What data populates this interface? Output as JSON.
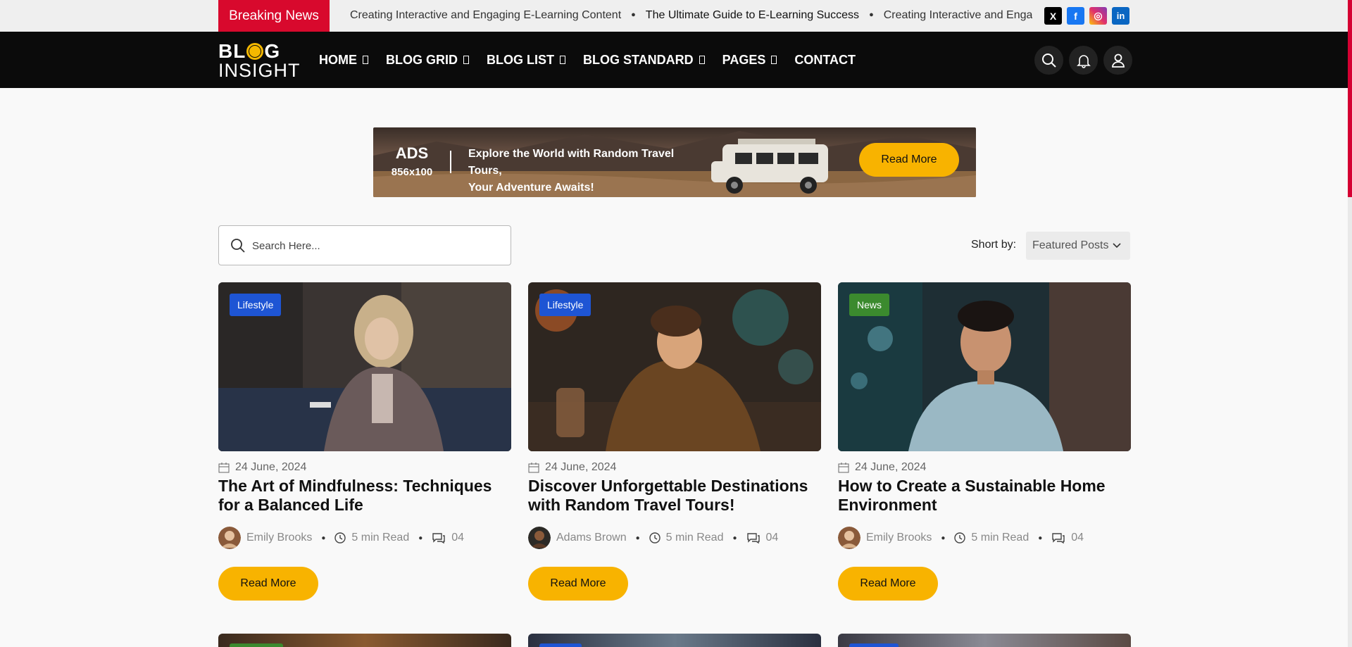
{
  "topbar": {
    "breaking_label": "Breaking News",
    "ticker": [
      "Creating Interactive and Engaging E-Learning Content",
      "The Ultimate Guide to E-Learning Success",
      "Creating Interactive and Engaging E-Learning Content"
    ],
    "socials": [
      {
        "name": "x-icon",
        "glyph": "X",
        "color": "#000000"
      },
      {
        "name": "facebook-icon",
        "glyph": "f",
        "color": "#1877f2"
      },
      {
        "name": "instagram-icon",
        "glyph": "◎",
        "color": "#d6249f"
      },
      {
        "name": "linkedin-icon",
        "glyph": "in",
        "color": "#0a66c2"
      }
    ]
  },
  "nav": {
    "logo_line1_a": "BL",
    "logo_line1_b": "G",
    "logo_line2": "INSIGHT",
    "items": [
      {
        "label": "HOME",
        "has_caret": true
      },
      {
        "label": "BLOG GRID",
        "has_caret": true
      },
      {
        "label": "BLOG LIST",
        "has_caret": true
      },
      {
        "label": "BLOG STANDARD",
        "has_caret": true
      },
      {
        "label": "PAGES",
        "has_caret": true
      },
      {
        "label": "CONTACT",
        "has_caret": false
      }
    ]
  },
  "ad": {
    "title": "ADS",
    "size": "856x100",
    "text_line1": "Explore the World with Random Travel Tours,",
    "text_line2": "Your Adventure Awaits!",
    "button": "Read More"
  },
  "search": {
    "placeholder": "Search Here..."
  },
  "sort": {
    "label": "Short by:",
    "selected": "Featured Posts"
  },
  "colors": {
    "accent": "#f8b300",
    "breaking": "#d8092d",
    "lifestyle": "#1e55d4",
    "news": "#3b8a2e"
  },
  "posts": [
    {
      "tag": "Lifestyle",
      "date": "24 June, 2024",
      "title": "The Art of Mindfulness: Techniques for a Balanced Life",
      "author": "Emily Brooks",
      "read": "5 min Read",
      "comments": "04",
      "button": "Read More"
    },
    {
      "tag": "Lifestyle",
      "date": "24 June, 2024",
      "title": "Discover Unforgettable Destinations with Random Travel Tours!",
      "author": "Adams Brown",
      "read": "5 min Read",
      "comments": "04",
      "button": "Read More"
    },
    {
      "tag": "News",
      "date": "24 June, 2024",
      "title": "How to Create a Sustainable Home Environment",
      "author": "Emily Brooks",
      "read": "5 min Read",
      "comments": "04",
      "button": "Read More"
    }
  ]
}
